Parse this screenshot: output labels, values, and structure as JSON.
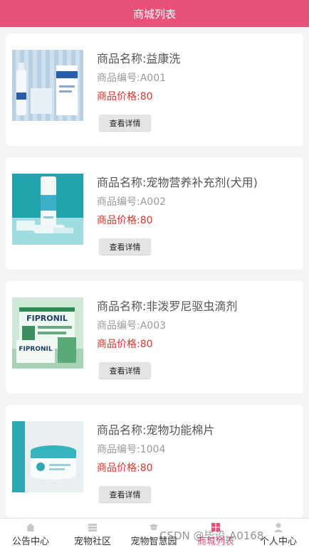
{
  "header": {
    "title": "商城列表"
  },
  "products": [
    {
      "name": "商品名称:益康洗",
      "code": "商品编号:A001",
      "price": "商品价格:80",
      "button": "查看详情"
    },
    {
      "name": "商品名称:宠物营养补充剂(犬用)",
      "code": "商品编号:A002",
      "price": "商品价格:80",
      "button": "查看详情"
    },
    {
      "name": "商品名称:非泼罗尼驱虫滴剂",
      "code": "商品编号:A003",
      "price": "商品价格:80",
      "button": "查看详情",
      "image_text": "FIPRONIL"
    },
    {
      "name": "商品名称:宠物功能棉片",
      "code": "商品编号:1004",
      "price": "商品价格:80",
      "button": "查看详情"
    }
  ],
  "tabbar": {
    "items": [
      {
        "label": "公告中心",
        "icon": "home-icon"
      },
      {
        "label": "宠物社区",
        "icon": "community-icon"
      },
      {
        "label": "宠物智慧园",
        "icon": "graduation-cap-icon"
      },
      {
        "label": "商城列表",
        "icon": "grid-icon",
        "active": true
      },
      {
        "label": "个人中心",
        "icon": "user-icon"
      }
    ]
  },
  "watermark": "CSDN @毕设-A0168",
  "colors": {
    "header": "#e8527a",
    "price": "#d9362c",
    "active_tab": "#e8527a"
  }
}
